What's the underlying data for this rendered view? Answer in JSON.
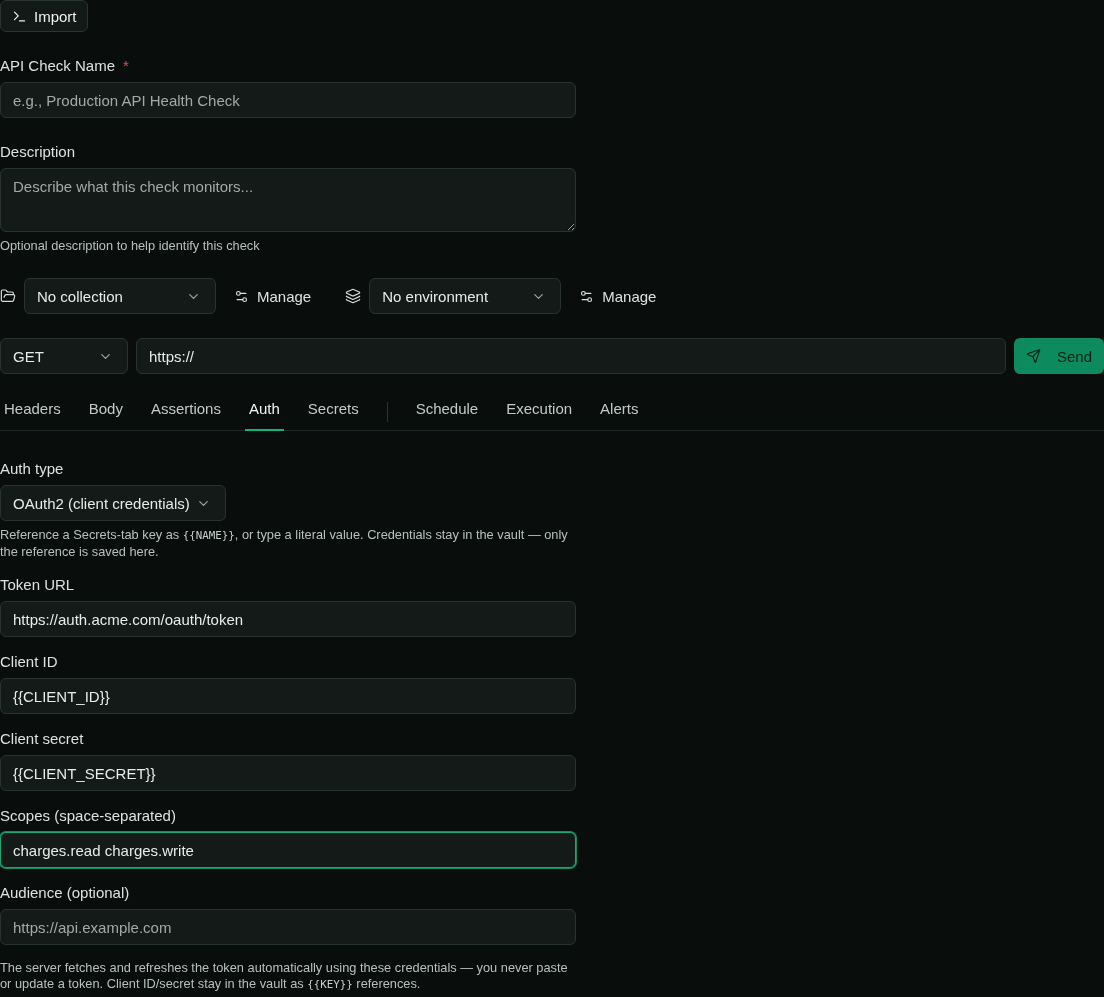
{
  "toolbar": {
    "import_button": "Import"
  },
  "name_field": {
    "label": "API Check Name",
    "required_mark": "*",
    "placeholder": "e.g., Production API Health Check"
  },
  "description_field": {
    "label": "Description",
    "placeholder": "Describe what this check monitors...",
    "hint": "Optional description to help identify this check"
  },
  "scope_row": {
    "collection": {
      "value": "No collection",
      "manage": "Manage"
    },
    "environment": {
      "value": "No environment",
      "manage": "Manage"
    }
  },
  "request": {
    "method": "GET",
    "url": "https://",
    "send": "Send"
  },
  "tab_groups": [
    {
      "tabs": [
        {
          "label": "Headers",
          "selected": false
        },
        {
          "label": "Body",
          "selected": false
        },
        {
          "label": "Assertions",
          "selected": false
        },
        {
          "label": "Auth",
          "selected": true
        },
        {
          "label": "Secrets",
          "selected": false
        }
      ]
    },
    {
      "tabs": [
        {
          "label": "Schedule",
          "selected": false
        },
        {
          "label": "Execution",
          "selected": false
        },
        {
          "label": "Alerts",
          "selected": false
        }
      ]
    }
  ],
  "auth": {
    "type_label": "Auth type",
    "type": "OAuth2 (client credentials)",
    "hint": [
      {
        "kind": "text",
        "text": "Reference a Secrets-tab key as "
      },
      {
        "kind": "code",
        "text": "{{NAME}}"
      },
      {
        "kind": "text",
        "text": ", or type a literal value. Credentials stay in the vault — only the reference is saved here."
      }
    ],
    "fields": [
      {
        "label": "Token URL",
        "value": "https://auth.acme.com/oauth/token",
        "focused": false
      },
      {
        "label": "Client ID",
        "value": "{{CLIENT_ID}}",
        "focused": false
      },
      {
        "label": "Client secret",
        "value": "{{CLIENT_SECRET}}",
        "focused": false
      },
      {
        "label": "Scopes (space-separated)",
        "value": "charges.read charges.write",
        "focused": true
      },
      {
        "label": "Audience (optional)",
        "placeholder": "https://api.example.com",
        "focused": false
      }
    ],
    "footer": [
      {
        "kind": "text",
        "text": "The server fetches and refreshes the token automatically using these credentials — you never paste or update a token. Client ID/secret stay in the vault as "
      },
      {
        "kind": "code",
        "text": "{{KEY}}"
      },
      {
        "kind": "text",
        "text": " references."
      }
    ]
  }
}
